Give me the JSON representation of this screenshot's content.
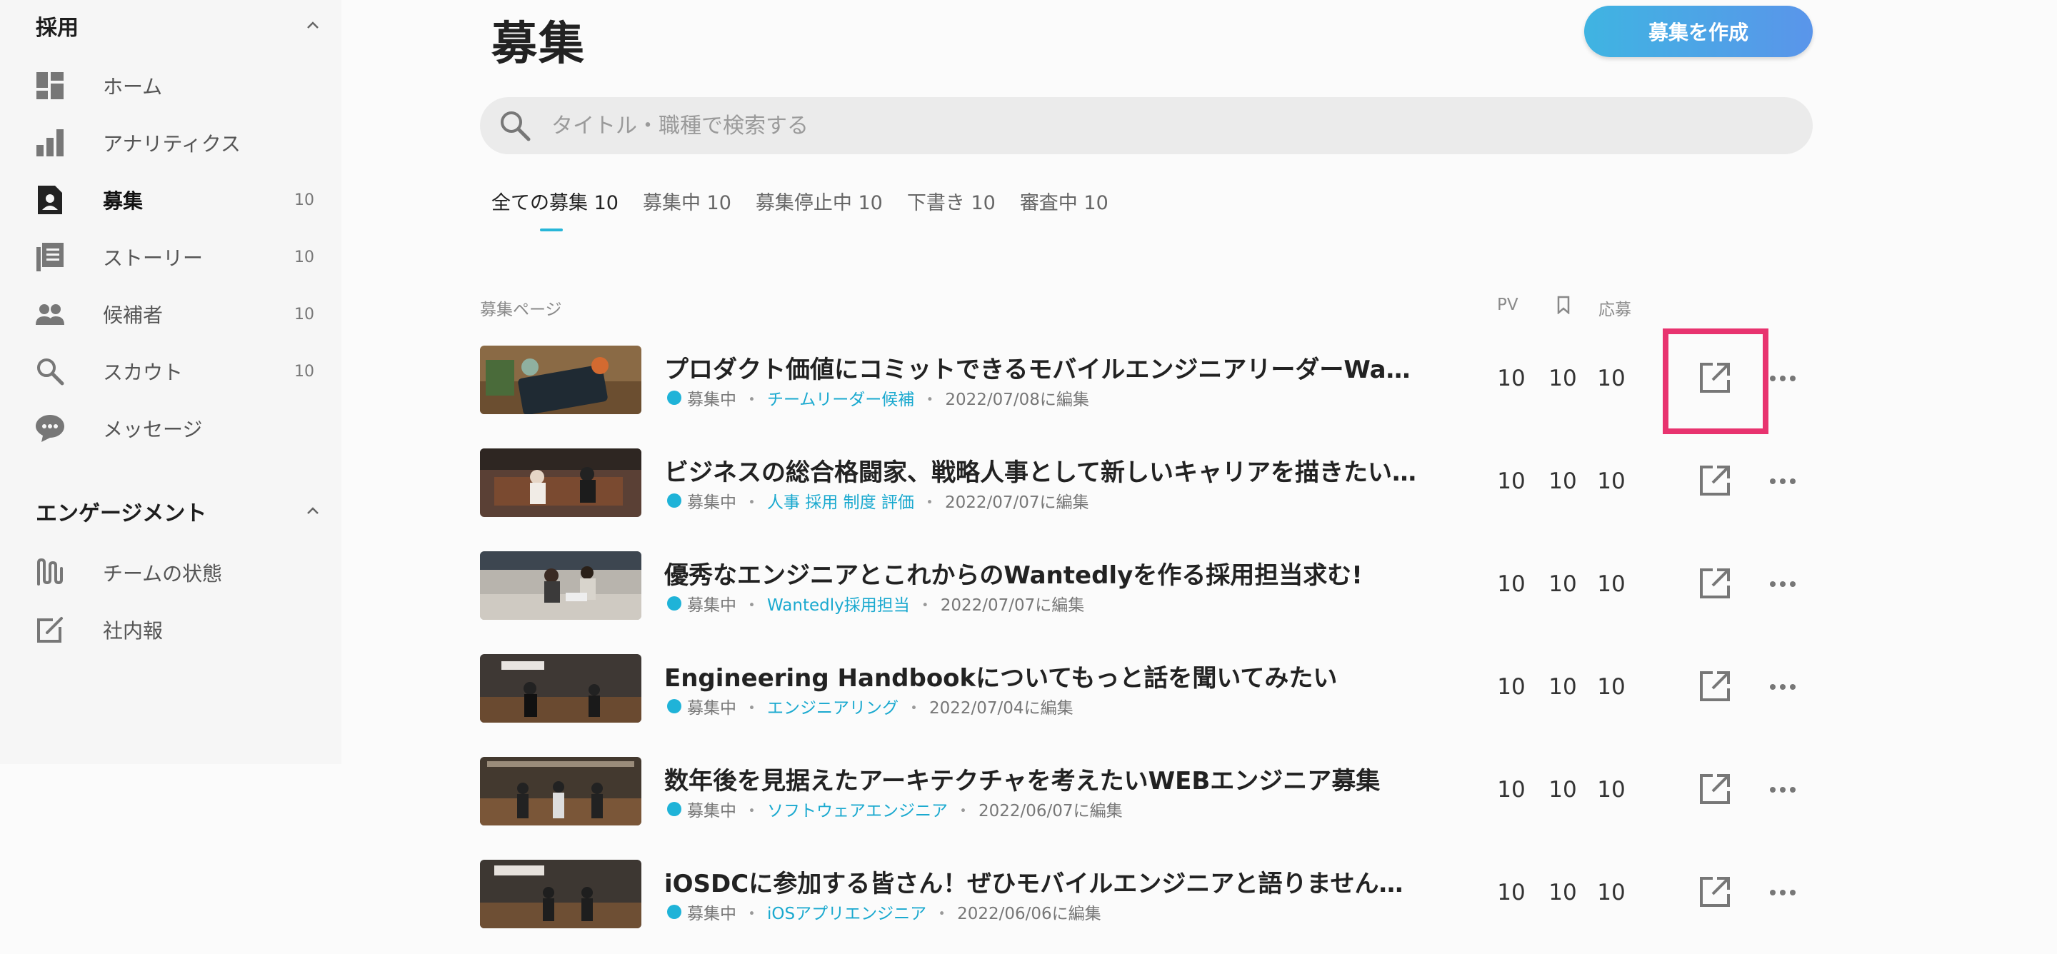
{
  "sidebar": {
    "section1": {
      "title": "採用"
    },
    "items": [
      {
        "label": "ホーム",
        "count": "",
        "icon": "dashboard-icon"
      },
      {
        "label": "アナリティクス",
        "count": "",
        "icon": "bar-chart-icon"
      },
      {
        "label": "募集",
        "count": "10",
        "icon": "recruit-icon"
      },
      {
        "label": "ストーリー",
        "count": "10",
        "icon": "story-icon"
      },
      {
        "label": "候補者",
        "count": "10",
        "icon": "people-icon"
      },
      {
        "label": "スカウト",
        "count": "10",
        "icon": "search-icon"
      },
      {
        "label": "メッセージ",
        "count": "",
        "icon": "chat-bubble-icon"
      }
    ],
    "section2": {
      "title": "エンゲージメント"
    },
    "items2": [
      {
        "label": "チームの状態",
        "icon": "team-pulse-icon"
      },
      {
        "label": "社内報",
        "icon": "edit-note-icon"
      }
    ]
  },
  "main": {
    "title": "募集",
    "create_label": "募集を作成",
    "search_placeholder": "タイトル・職種で検索する",
    "tabs": [
      {
        "label": "全ての募集 10",
        "active": true
      },
      {
        "label": "募集中 10"
      },
      {
        "label": "募集停止中 10"
      },
      {
        "label": "下書き 10"
      },
      {
        "label": "審査中 10"
      }
    ],
    "columns": {
      "page": "募集ページ",
      "pv": "PV",
      "apply": "応募"
    },
    "rows": [
      {
        "title": "プロダクト価値にコミットできるモバイルエンジニアリーダーWante...",
        "status": "募集中",
        "tag": "チームリーダー候補",
        "date": "2022/07/08に編集",
        "pv": "10",
        "bookmarks": "10",
        "applies": "10"
      },
      {
        "title": "ビジネスの総合格闘家、戦略人事として新しいキャリアを描きたい人...",
        "status": "募集中",
        "tag": "人事 採用 制度 評価",
        "date": "2022/07/07に編集",
        "pv": "10",
        "bookmarks": "10",
        "applies": "10"
      },
      {
        "title": "優秀なエンジニアとこれからのWantedlyを作る採用担当求む!",
        "status": "募集中",
        "tag": "Wantedly採用担当",
        "date": "2022/07/07に編集",
        "pv": "10",
        "bookmarks": "10",
        "applies": "10"
      },
      {
        "title": "Engineering Handbookについてもっと話を聞いてみたい",
        "status": "募集中",
        "tag": "エンジニアリング",
        "date": "2022/07/04に編集",
        "pv": "10",
        "bookmarks": "10",
        "applies": "10"
      },
      {
        "title": "数年後を見据えたアーキテクチャを考えたいWEBエンジニア募集",
        "status": "募集中",
        "tag": "ソフトウェアエンジニア",
        "date": "2022/06/07に編集",
        "pv": "10",
        "bookmarks": "10",
        "applies": "10"
      },
      {
        "title": "iOSDCに参加する皆さん！ぜひモバイルエンジニアと語りませんか？",
        "status": "募集中",
        "tag": "iOSアプリエンジニア",
        "date": "2022/06/06に編集",
        "pv": "10",
        "bookmarks": "10",
        "applies": "10"
      }
    ]
  },
  "colors": {
    "accent": "#1fb3d8",
    "button_gradient_start": "#3fb4e2",
    "button_gradient_end": "#5a95ea",
    "highlight": "#e8336f"
  }
}
